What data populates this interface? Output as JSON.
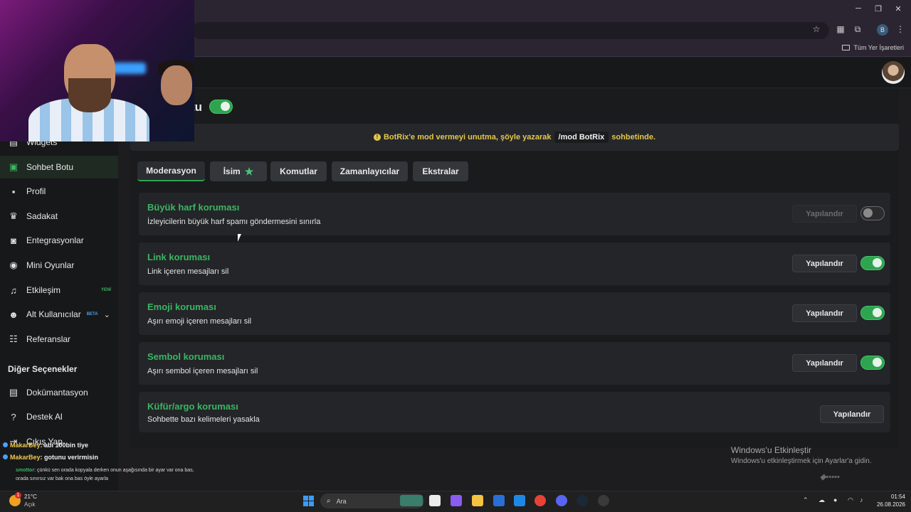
{
  "browser": {
    "bookmarks_all_label": "Tüm Yer İşaretleri",
    "profile_initial": "B"
  },
  "sidebar": {
    "items": [
      {
        "label": "Widgets",
        "icon": "widgets-icon"
      },
      {
        "label": "Sohbet Botu",
        "icon": "bot-icon",
        "active": true
      },
      {
        "label": "Profil",
        "icon": "profile-card-icon"
      },
      {
        "label": "Sadakat",
        "icon": "trophy-icon"
      },
      {
        "label": "Entegrasyonlar",
        "icon": "integrations-icon"
      },
      {
        "label": "Mini Oyunlar",
        "icon": "gamepad-icon"
      },
      {
        "label": "Etkileşim",
        "icon": "music-note-icon",
        "badge": "YENİ",
        "badge_color": "#3cb563"
      },
      {
        "label": "Alt Kullanıcılar",
        "icon": "users-icon",
        "badge": "BETA",
        "badge_color": "#4aa0e8"
      },
      {
        "label": "Referanslar",
        "icon": "referrals-icon"
      }
    ],
    "section_heading": "Diğer Seçenekler",
    "other_items": [
      {
        "label": "Dokümantasyon",
        "icon": "docs-icon"
      },
      {
        "label": "Destek Al",
        "icon": "help-icon"
      },
      {
        "label": "Çıkış Yap",
        "icon": "logout-icon"
      }
    ]
  },
  "page": {
    "title": "tu",
    "enabled": true
  },
  "alert": {
    "text_before": "BotRix'e mod vermeyi unutma, şöyle yazarak",
    "command": "/mod BotRix",
    "text_after": "sohbetinde."
  },
  "tabs": [
    {
      "label": "Moderasyon",
      "active": true
    },
    {
      "label": "İsim",
      "star": true
    },
    {
      "label": "Komutlar"
    },
    {
      "label": "Zamanlayıcılar"
    },
    {
      "label": "Ekstralar"
    }
  ],
  "cards": [
    {
      "title": "Büyük harf koruması",
      "desc": "İzleyicilerin büyük harf spamı göndermesini sınırla",
      "button": "Yapılandır",
      "button_disabled": true,
      "toggle": false
    },
    {
      "title": "Link koruması",
      "desc": "Link içeren mesajları sil",
      "button": "Yapılandır",
      "toggle": true
    },
    {
      "title": "Emoji koruması",
      "desc": "Aşırı emoji içeren mesajları sil",
      "button": "Yapılandır",
      "toggle": true
    },
    {
      "title": "Sembol koruması",
      "desc": "Aşırı sembol içeren mesajları sil",
      "button": "Yapılandır",
      "toggle": true
    },
    {
      "title": "Küfür/argo koruması",
      "desc": "Sohbette bazı kelimeleri yasakla",
      "button": "Yapılandır"
    }
  ],
  "chat": [
    {
      "user": "MakarBey",
      "message": ": abi 100bin tiye"
    },
    {
      "user": "MakarBey",
      "message": ": gotunu verirmisin"
    }
  ],
  "chat_small": {
    "user": "smottor",
    "line1": ": çünkü sen orada kopyala derken onun aşağısında bir ayar var ona bas,",
    "line2": "orada sınırsız var bak ona bas öyle ayarla"
  },
  "windows": {
    "activate_title": "Windows'u Etkinleştir",
    "activate_desc": "Windows'u etkinleştirmek için Ayarlar'a gidin.",
    "search_placeholder": "Ara",
    "weather_temp": "21°C",
    "weather_desc": "Açık",
    "weather_badge": "1",
    "clock_time": "01:54",
    "clock_date": "26.08.2026"
  },
  "colors": {
    "accent_green": "#2ea44f",
    "alert_yellow": "#e5c84a"
  }
}
